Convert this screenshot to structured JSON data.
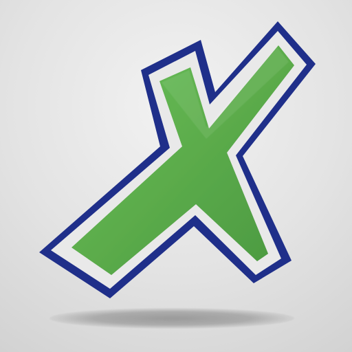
{
  "icon": {
    "name": "x-logo-icon",
    "colors": {
      "background_top": "#f2f2f2",
      "background_bottom": "#d2d2d2",
      "outline": "#1f2f8a",
      "frame": "#e7e7e7",
      "green": "#5aaa4a",
      "green_dark": "#3f8a36",
      "shadow": "#9a9a9a"
    }
  }
}
